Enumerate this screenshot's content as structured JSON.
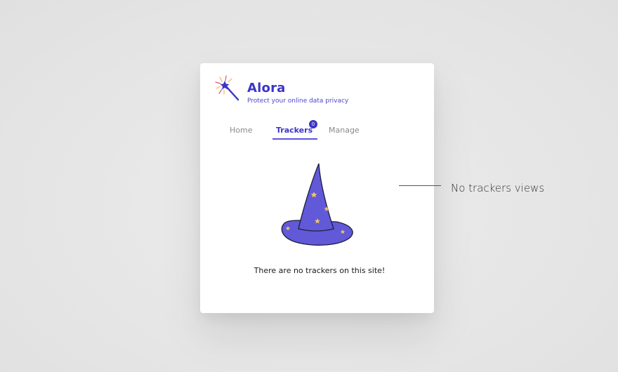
{
  "app": {
    "name": "Alora",
    "tagline": "Protect your online data privacy",
    "brand_color": "#3b35c8",
    "logo_icon": "magic-wand-icon"
  },
  "tabs": [
    {
      "label": "Home",
      "active": false
    },
    {
      "label": "Trackers",
      "active": true,
      "badge": "0"
    },
    {
      "label": "Manage",
      "active": false
    }
  ],
  "main": {
    "illustration": "wizard-hat-icon",
    "empty_message": "There are no trackers on this site!"
  },
  "annotation": {
    "label": "No trackers views"
  }
}
